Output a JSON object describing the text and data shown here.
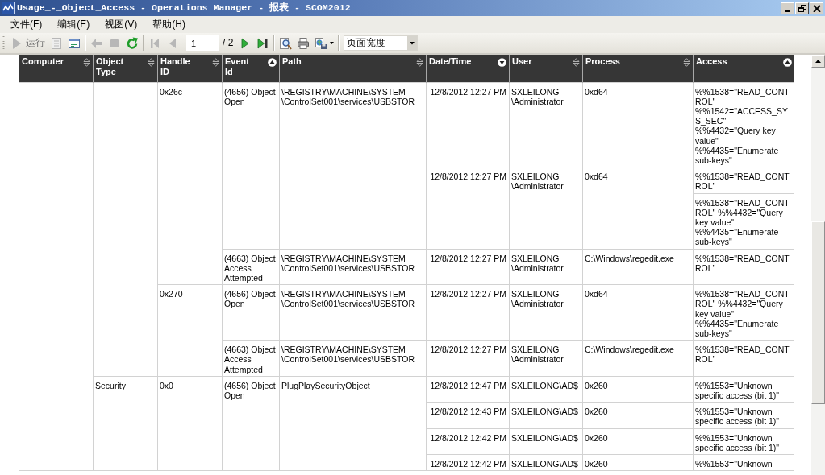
{
  "window": {
    "title": "Usage_-_Object_Access - Operations Manager - 报表 - SCOM2012"
  },
  "menu": [
    {
      "label": "文件(F)"
    },
    {
      "label": "编辑(E)"
    },
    {
      "label": "视图(V)"
    },
    {
      "label": "帮助(H)"
    }
  ],
  "toolbar": {
    "groups": [
      {
        "items": [
          {
            "kind": "run",
            "label": "运行",
            "disabled": true
          },
          {
            "kind": "parameters",
            "disabled": true
          },
          {
            "kind": "document-map",
            "disabled": false
          }
        ]
      },
      {
        "items": [
          {
            "kind": "back",
            "disabled": true
          },
          {
            "kind": "stop",
            "disabled": true
          },
          {
            "kind": "refresh",
            "disabled": false
          }
        ]
      },
      {
        "items": [
          {
            "kind": "first",
            "disabled": true
          },
          {
            "kind": "previous",
            "disabled": true
          },
          {
            "kind": "page-field",
            "value": "1"
          },
          {
            "kind": "page-total",
            "text": "/ 2"
          },
          {
            "kind": "next",
            "disabled": false
          },
          {
            "kind": "last",
            "disabled": false
          }
        ]
      },
      {
        "items": [
          {
            "kind": "find",
            "disabled": false
          },
          {
            "kind": "print",
            "disabled": false
          },
          {
            "kind": "export",
            "disabled": false
          }
        ]
      },
      {
        "items": [
          {
            "kind": "zoom",
            "value": "页面宽度"
          }
        ]
      }
    ]
  },
  "table": {
    "columns": [
      {
        "label": "Computer",
        "sort_ascending": false,
        "sort_descending": false
      },
      {
        "label": "Object Type",
        "sort_ascending": false,
        "sort_descending": false
      },
      {
        "label": "Handle ID",
        "sort_ascending": false,
        "sort_descending": false
      },
      {
        "label": "Event Id",
        "sort_ascending": true,
        "sort_descending": false
      },
      {
        "label": "Path",
        "sort_ascending": false,
        "sort_descending": false
      },
      {
        "label": "Date/Time",
        "sort_ascending": false,
        "sort_descending": true
      },
      {
        "label": "User",
        "sort_ascending": false,
        "sort_descending": false
      },
      {
        "label": "Process",
        "sort_ascending": false,
        "sort_descending": false
      },
      {
        "label": "Access",
        "sort_ascending": true,
        "sort_descending": false
      }
    ],
    "object_types": [
      {
        "handles": [
          {
            "handle_id": "0x26c",
            "events": [
              {
                "event_id": "(4656) Object Open",
                "path": "\\REGISTRY\\MACHINE\\SYSTEM\\ControlSet001\\services\\USBSTOR",
                "occurrences": [
                  {
                    "date_time": "12/8/2012 12:27 PM",
                    "user": "SXLEILONG\\Administrator",
                    "process": "0xd64",
                    "access": [
                      "%%1538=\"READ_CONTROL\" %%1542=\"ACCESS_SYS_SEC\" %%4432=\"Query key value\" %%4435=\"Enumerate sub-keys\""
                    ]
                  },
                  {
                    "date_time": "12/8/2012 12:27 PM",
                    "user": "SXLEILONG\\Administrator",
                    "process": "0xd64",
                    "access": [
                      "%%1538=\"READ_CONTROL\"",
                      "%%1538=\"READ_CONTROL\" %%4432=\"Query key value\" %%4435=\"Enumerate sub-keys\""
                    ]
                  }
                ]
              },
              {
                "event_id": "(4663) Object Access Attempted",
                "path": "\\REGISTRY\\MACHINE\\SYSTEM\\ControlSet001\\services\\USBSTOR",
                "occurrences": [
                  {
                    "date_time": "12/8/2012 12:27 PM",
                    "user": "SXLEILONG\\Administrator",
                    "process": "C:\\Windows\\regedit.exe",
                    "access": [
                      "%%1538=\"READ_CONTROL\""
                    ]
                  }
                ]
              }
            ]
          },
          {
            "handle_id": "0x270",
            "events": [
              {
                "event_id": "(4656) Object Open",
                "path": "\\REGISTRY\\MACHINE\\SYSTEM\\ControlSet001\\services\\USBSTOR",
                "occurrences": [
                  {
                    "date_time": "12/8/2012 12:27 PM",
                    "user": "SXLEILONG\\Administrator",
                    "process": "0xd64",
                    "access": [
                      "%%1538=\"READ_CONTROL\" %%4432=\"Query key value\" %%4435=\"Enumerate sub-keys\""
                    ]
                  }
                ]
              },
              {
                "event_id": "(4663) Object Access Attempted",
                "path": "\\REGISTRY\\MACHINE\\SYSTEM\\ControlSet001\\services\\USBSTOR",
                "occurrences": [
                  {
                    "date_time": "12/8/2012 12:27 PM",
                    "user": "SXLEILONG\\Administrator",
                    "process": "C:\\Windows\\regedit.exe",
                    "access": [
                      "%%1538=\"READ_CONTROL\""
                    ]
                  }
                ]
              }
            ]
          }
        ]
      },
      {
        "object_type": "Security",
        "handles": [
          {
            "handle_id": "0x0",
            "events": [
              {
                "event_id": "(4656) Object Open",
                "path": "PlugPlaySecurityObject",
                "occurrences": [
                  {
                    "date_time": "12/8/2012 12:47 PM",
                    "user": "SXLEILONG\\AD$",
                    "process": "0x260",
                    "access": [
                      "%%1553=\"Unknown specific access (bit 1)\""
                    ]
                  },
                  {
                    "date_time": "12/8/2012 12:43 PM",
                    "user": "SXLEILONG\\AD$",
                    "process": "0x260",
                    "access": [
                      "%%1553=\"Unknown specific access (bit 1)\""
                    ]
                  },
                  {
                    "date_time": "12/8/2012 12:42 PM",
                    "user": "SXLEILONG\\AD$",
                    "process": "0x260",
                    "access": [
                      "%%1553=\"Unknown specific access (bit 1)\""
                    ]
                  },
                  {
                    "date_time": "12/8/2012 12:42 PM",
                    "user": "SXLEILONG\\AD$",
                    "process": "0x260",
                    "access": [
                      "%%1553=\"Unknown"
                    ]
                  }
                ]
              }
            ]
          }
        ]
      }
    ]
  }
}
